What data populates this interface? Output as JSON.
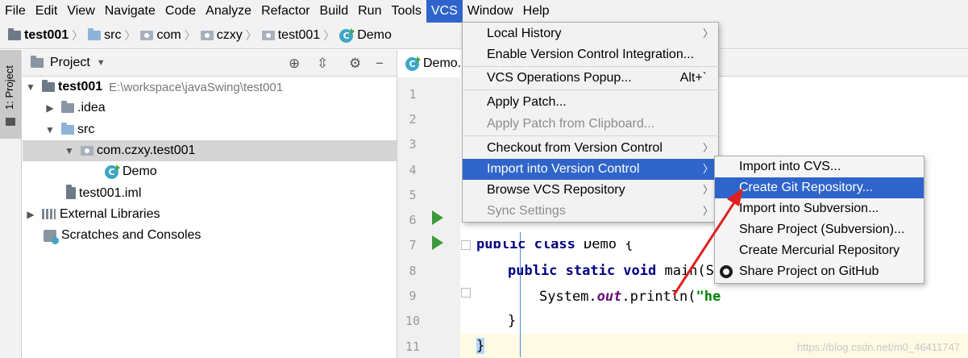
{
  "menubar": {
    "items": [
      "File",
      "Edit",
      "View",
      "Navigate",
      "Code",
      "Analyze",
      "Refactor",
      "Build",
      "Run",
      "Tools",
      "VCS",
      "Window",
      "Help"
    ],
    "active": "VCS"
  },
  "breadcrumb": [
    "test001",
    "src",
    "com",
    "czxy",
    "test001",
    "Demo"
  ],
  "left_stripe": {
    "label": "1: Project"
  },
  "project_panel": {
    "title": "Project",
    "tree": [
      {
        "label": "test001",
        "detail": "E:\\workspace\\javaSwing\\test001",
        "icon": "module-folder-icon",
        "expanded": true
      },
      {
        "label": ".idea",
        "icon": "folder-icon",
        "expanded": false
      },
      {
        "label": "src",
        "icon": "source-folder-icon",
        "expanded": true
      },
      {
        "label": "com.czxy.test001",
        "icon": "package-icon",
        "expanded": true,
        "selected": true
      },
      {
        "label": "Demo",
        "icon": "java-class-icon"
      },
      {
        "label": "test001.iml",
        "icon": "iml-file-icon"
      },
      {
        "label": "External Libraries",
        "icon": "libraries-icon",
        "expanded": false
      },
      {
        "label": "Scratches and Consoles",
        "icon": "scratches-icon"
      }
    ]
  },
  "editor": {
    "tab_label": "Demo.",
    "line_numbers": [
      "1",
      "2",
      "3",
      "4",
      "5",
      "6",
      "7",
      "8",
      "9",
      "10",
      "11"
    ],
    "code": {
      "line6_kw": "public class",
      "line6_rest": " Demo {",
      "line7_kw": "public static void",
      "line7_rest": " main(St",
      "line8_a": "System.",
      "line8_field": "out",
      "line8_b": ".println(",
      "line8_str": "\"he",
      "line9": "}",
      "line10": "}"
    }
  },
  "vcs_menu": {
    "items": [
      {
        "label": "Local History",
        "submenu": true
      },
      {
        "label": "Enable Version Control Integration..."
      },
      {
        "label": "VCS Operations Popup...",
        "shortcut": "Alt+`"
      },
      {
        "label": "Apply Patch..."
      },
      {
        "label": "Apply Patch from Clipboard...",
        "disabled": true
      },
      {
        "label": "Checkout from Version Control",
        "submenu": true
      },
      {
        "label": "Import into Version Control",
        "submenu": true,
        "highlighted": true
      },
      {
        "label": "Browse VCS Repository",
        "submenu": true
      },
      {
        "label": "Sync Settings",
        "submenu": true,
        "disabled": true
      }
    ]
  },
  "import_submenu": {
    "items": [
      {
        "label": "Import into CVS..."
      },
      {
        "label": "Create Git Repository...",
        "highlighted": true
      },
      {
        "label": "Import into Subversion..."
      },
      {
        "label": "Share Project (Subversion)..."
      },
      {
        "label": "Create Mercurial Repository"
      },
      {
        "label": "Share Project on GitHub",
        "icon": "github-icon"
      }
    ]
  },
  "watermark": "https://blog.csdn.net/m0_46411747",
  "colors": {
    "highlight": "#2f65ca",
    "annotation_arrow": "#e02020",
    "run_icon": "#3c9a3c"
  }
}
